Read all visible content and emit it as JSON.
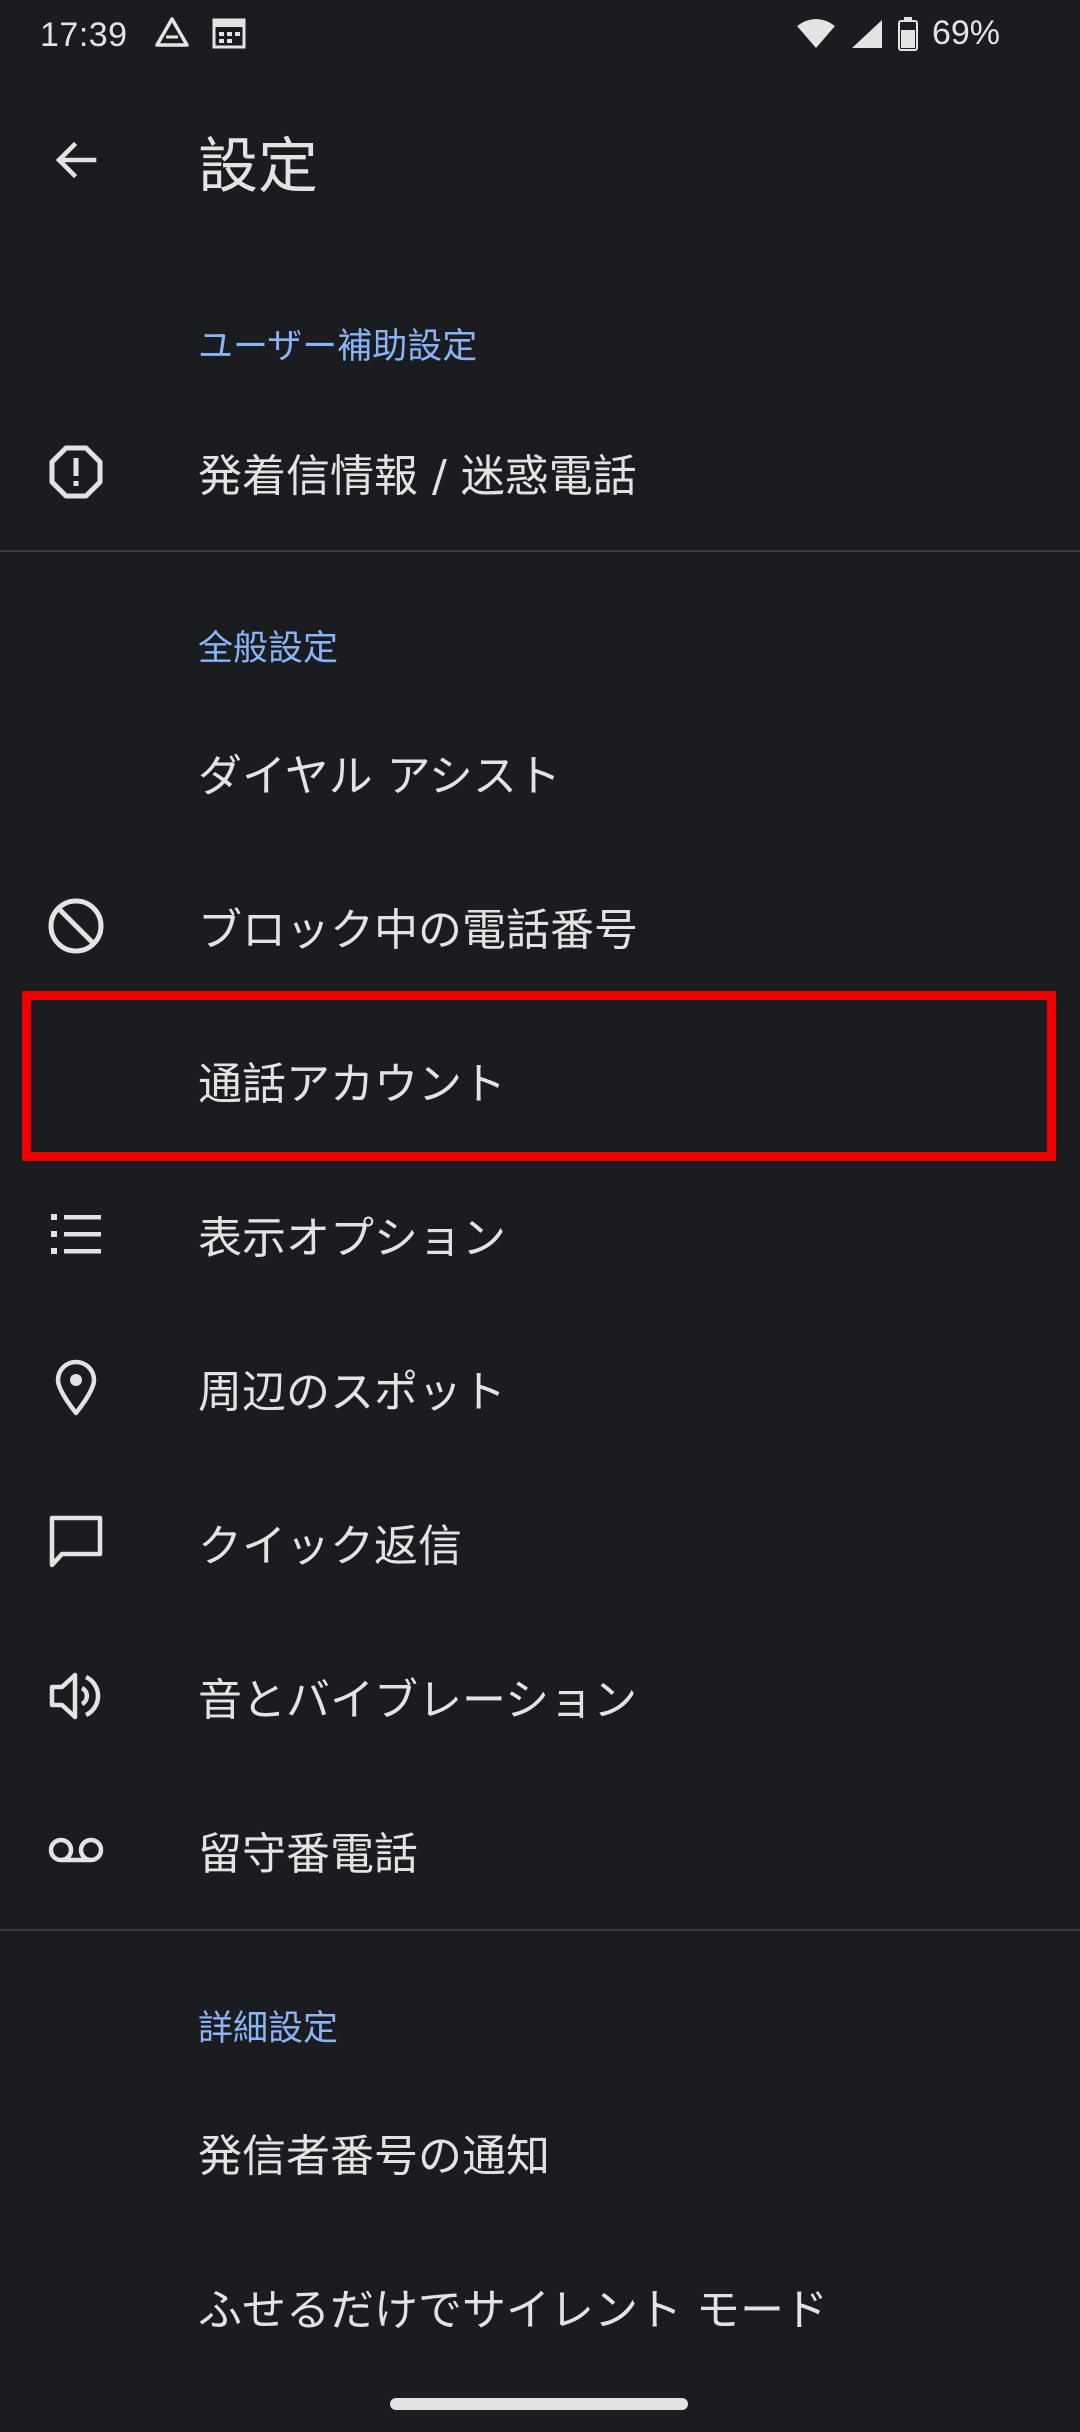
{
  "status_bar": {
    "time": "17:39",
    "battery_percent": "69%",
    "icons": [
      "drive-icon",
      "calendar-icon",
      "wifi-icon",
      "signal-icon",
      "battery-icon"
    ]
  },
  "app_bar": {
    "title": "設定",
    "back_icon": "arrow-back-icon"
  },
  "sections": [
    {
      "header": "ユーザー補助設定",
      "items": [
        {
          "label": "発着信情報 / 迷惑電話",
          "icon": "report-icon"
        }
      ]
    },
    {
      "header": "全般設定",
      "items": [
        {
          "label": "ダイヤル アシスト",
          "icon": ""
        },
        {
          "label": "ブロック中の電話番号",
          "icon": "block-icon"
        },
        {
          "label": "通話アカウント",
          "icon": ""
        },
        {
          "label": "表示オプション",
          "icon": "list-icon"
        },
        {
          "label": "周辺のスポット",
          "icon": "location-pin-icon"
        },
        {
          "label": "クイック返信",
          "icon": "chat-bubble-icon"
        },
        {
          "label": "音とバイブレーション",
          "icon": "volume-icon"
        },
        {
          "label": "留守番電話",
          "icon": "voicemail-icon"
        }
      ]
    },
    {
      "header": "詳細設定",
      "items": [
        {
          "label": "発信者番号の通知",
          "icon": ""
        },
        {
          "label": "ふせるだけでサイレント モード",
          "icon": ""
        }
      ]
    }
  ],
  "colors": {
    "background": "#1b1c1f",
    "text": "#e3e3e3",
    "section_header": "#8ab4f8",
    "highlight": "#ee0000",
    "divider": "#3c3d40"
  }
}
